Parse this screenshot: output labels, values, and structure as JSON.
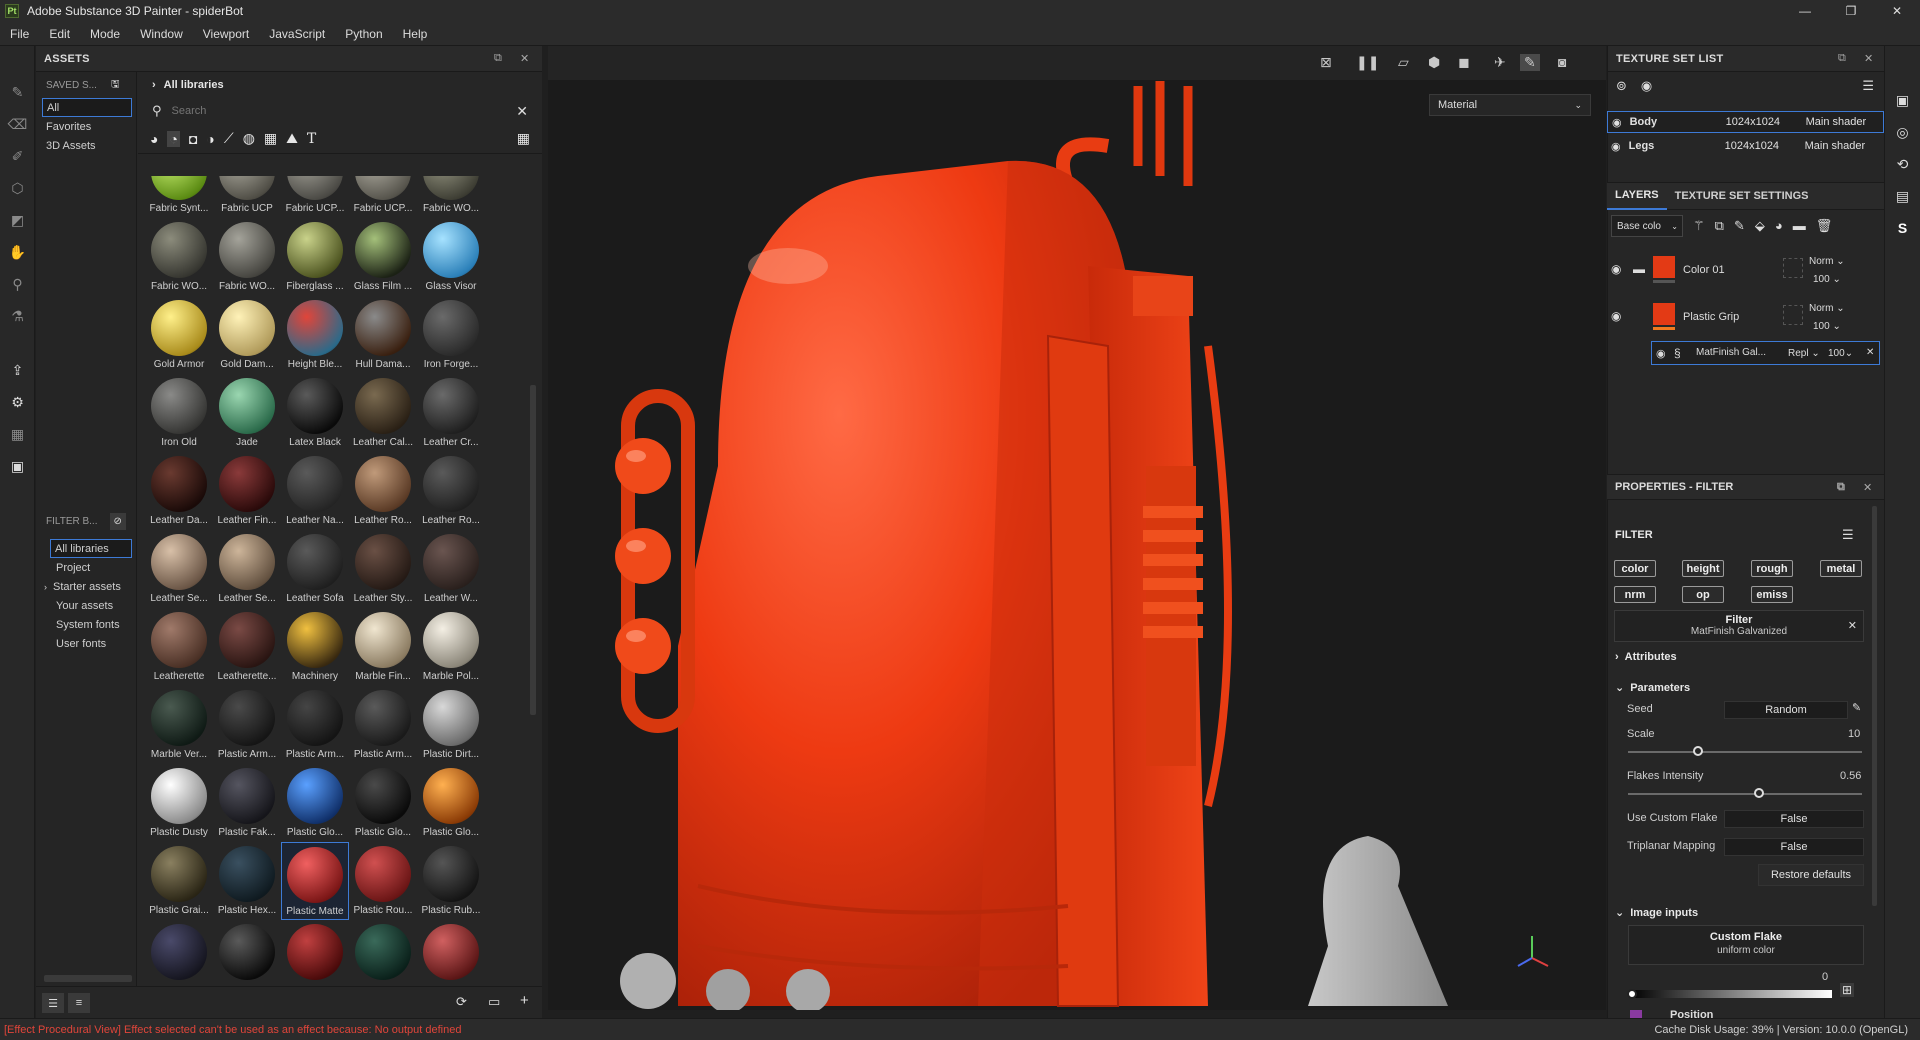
{
  "app": {
    "logo": "Pt",
    "title": "Adobe Substance 3D Painter - spiderBot",
    "window_controls": [
      "—",
      "❐",
      "✕"
    ]
  },
  "menu": [
    "File",
    "Edit",
    "Mode",
    "Window",
    "Viewport",
    "JavaScript",
    "Python",
    "Help"
  ],
  "left_tools": [
    "paint-brush-icon",
    "eraser-icon",
    "projection-icon",
    "geometry-fill-icon",
    "polygon-fill-icon",
    "smudge-icon",
    "clone-icon",
    "color-picker-icon",
    "export-icon",
    "bake-icon",
    "texture-icon",
    "screenshot-icon"
  ],
  "assets": {
    "title": "ASSETS",
    "saved_label": "SAVED S...",
    "side_items": [
      "All",
      "Favorites",
      "3D Assets"
    ],
    "filter_label": "FILTER B...",
    "libraries": [
      "All libraries",
      "Project",
      "Starter assets",
      "Your assets",
      "System fonts",
      "User fonts"
    ],
    "breadcrumb": "All libraries",
    "search_placeholder": "Search",
    "thumbs": [
      {
        "label": "Fabric Synt...",
        "c1": "#c8f070",
        "c2": "#5a8a12"
      },
      {
        "label": "Fabric UCP",
        "c1": "#b0aea2",
        "c2": "#4f4d45"
      },
      {
        "label": "Fabric UCP...",
        "c1": "#a8a69c",
        "c2": "#4a4944"
      },
      {
        "label": "Fabric UCP...",
        "c1": "#b5b2a6",
        "c2": "#55534b"
      },
      {
        "label": "Fabric WO...",
        "c1": "#9a9a86",
        "c2": "#3d3d33"
      },
      {
        "label": "Fabric WO...",
        "c1": "#8c8c7c",
        "c2": "#363630"
      },
      {
        "label": "Fabric WO...",
        "c1": "#a4a39a",
        "c2": "#45443f"
      },
      {
        "label": "Fiberglass ...",
        "c1": "#c9d28a",
        "c2": "#4d5420"
      },
      {
        "label": "Glass Film ...",
        "c1": "#a4c07a",
        "c2": "#1c2215"
      },
      {
        "label": "Glass Visor",
        "c1": "#a6e2ff",
        "c2": "#2a7fb8"
      },
      {
        "label": "Gold Armor",
        "c1": "#fff08a",
        "c2": "#a88a1a"
      },
      {
        "label": "Gold Dam...",
        "c1": "#fff2b8",
        "c2": "#b09a5a"
      },
      {
        "label": "Height Ble...",
        "c1": "#e0453a",
        "c2": "#2a6a8a"
      },
      {
        "label": "Hull Dama...",
        "c1": "#8a8a8a",
        "c2": "#3a2010"
      },
      {
        "label": "Iron Forge...",
        "c1": "#6a6a6a",
        "c2": "#2a2a2a"
      },
      {
        "label": "Iron Old",
        "c1": "#8a8a88",
        "c2": "#353533"
      },
      {
        "label": "Jade",
        "c1": "#9ad6b0",
        "c2": "#2a6a4a"
      },
      {
        "label": "Latex Black",
        "c1": "#5a5a5a",
        "c2": "#0a0a0a"
      },
      {
        "label": "Leather Cal...",
        "c1": "#7a6a50",
        "c2": "#2a2015"
      },
      {
        "label": "Leather Cr...",
        "c1": "#6a6a6a",
        "c2": "#1f1f1f"
      },
      {
        "label": "Leather Da...",
        "c1": "#6a3a30",
        "c2": "#1a0a08"
      },
      {
        "label": "Leather Fin...",
        "c1": "#8a3a3a",
        "c2": "#2a0a0a"
      },
      {
        "label": "Leather Na...",
        "c1": "#5a5a5a",
        "c2": "#252525"
      },
      {
        "label": "Leather Ro...",
        "c1": "#c09a7a",
        "c2": "#5a3a25"
      },
      {
        "label": "Leather Ro...",
        "c1": "#5a5a5a",
        "c2": "#202020"
      },
      {
        "label": "Leather Se...",
        "c1": "#d8c0a8",
        "c2": "#6a5545"
      },
      {
        "label": "Leather Se...",
        "c1": "#cdb59a",
        "c2": "#62503f"
      },
      {
        "label": "Leather Sofa",
        "c1": "#5a5a5a",
        "c2": "#1f1f1f"
      },
      {
        "label": "Leather Sty...",
        "c1": "#6a5045",
        "c2": "#251a15"
      },
      {
        "label": "Leather W...",
        "c1": "#6a5550",
        "c2": "#2a201d"
      },
      {
        "label": "Leatherette",
        "c1": "#a07a6a",
        "c2": "#4a3025"
      },
      {
        "label": "Leatherette...",
        "c1": "#7a4a45",
        "c2": "#2a1512"
      },
      {
        "label": "Machinery",
        "c1": "#f0c040",
        "c2": "#3a2a10"
      },
      {
        "label": "Marble Fin...",
        "c1": "#f0e6d0",
        "c2": "#8a7a60"
      },
      {
        "label": "Marble Pol...",
        "c1": "#f4efe4",
        "c2": "#8a8578"
      },
      {
        "label": "Marble Ver...",
        "c1": "#4a5a50",
        "c2": "#0f1a15"
      },
      {
        "label": "Plastic Arm...",
        "c1": "#4a4a4a",
        "c2": "#151515"
      },
      {
        "label": "Plastic Arm...",
        "c1": "#454545",
        "c2": "#141414"
      },
      {
        "label": "Plastic Arm...",
        "c1": "#5a5a5a",
        "c2": "#1a1a1a"
      },
      {
        "label": "Plastic Dirt...",
        "c1": "#d8d8d8",
        "c2": "#6a6a6a"
      },
      {
        "label": "Plastic Dusty",
        "c1": "#ffffff",
        "c2": "#8a8a8a"
      },
      {
        "label": "Plastic Fak...",
        "c1": "#555560",
        "c2": "#15151a"
      },
      {
        "label": "Plastic Glo...",
        "c1": "#5aa0ff",
        "c2": "#10306a"
      },
      {
        "label": "Plastic Glo...",
        "c1": "#4a4a4a",
        "c2": "#0a0a0a"
      },
      {
        "label": "Plastic Glo...",
        "c1": "#ffb050",
        "c2": "#8a3a05"
      },
      {
        "label": "Plastic Grai...",
        "c1": "#8a8060",
        "c2": "#2a2515"
      },
      {
        "label": "Plastic Hex...",
        "c1": "#3a5060",
        "c2": "#0f1a20"
      },
      {
        "label": "Plastic Matte",
        "c1": "#f06060",
        "c2": "#7a1515"
      },
      {
        "label": "Plastic Rou...",
        "c1": "#d05050",
        "c2": "#6a1515"
      },
      {
        "label": "Plastic Rub...",
        "c1": "#555555",
        "c2": "#141414"
      },
      {
        "label": "",
        "c1": "#4a4a6a",
        "c2": "#15151f"
      },
      {
        "label": "",
        "c1": "#5a5a5a",
        "c2": "#0a0a0a"
      },
      {
        "label": "",
        "c1": "#c04040",
        "c2": "#4a0a0a"
      },
      {
        "label": "",
        "c1": "#3a6a5a",
        "c2": "#0a201a"
      },
      {
        "label": "",
        "c1": "#d06060",
        "c2": "#5a1515"
      }
    ],
    "selected_index": 47
  },
  "viewport": {
    "channel_select": "Material"
  },
  "texture_set_list": {
    "title": "TEXTURE SET LIST",
    "rows": [
      {
        "name": "Body",
        "res": "1024x1024",
        "shader": "Main shader"
      },
      {
        "name": "Legs",
        "res": "1024x1024",
        "shader": "Main shader"
      }
    ]
  },
  "layers": {
    "tab_layers": "LAYERS",
    "tab_tss": "TEXTURE SET SETTINGS",
    "channel": "Base colo",
    "items": [
      {
        "name": "Color 01",
        "blend": "Norm",
        "opacity": "100"
      },
      {
        "name": "Plastic Grip",
        "blend": "Norm",
        "opacity": "100"
      }
    ],
    "effect": {
      "name": "MatFinish Gal...",
      "blend": "Repl",
      "opacity": "100"
    }
  },
  "properties": {
    "title": "PROPERTIES - FILTER",
    "filter_heading": "FILTER",
    "chips": [
      "color",
      "height",
      "rough",
      "metal",
      "nrm",
      "op",
      "emiss"
    ],
    "filter_box_title": "Filter",
    "filter_box_sub": "MatFinish Galvanized",
    "attributes": "Attributes",
    "parameters": "Parameters",
    "seed_label": "Seed",
    "seed_value": "Random",
    "scale_label": "Scale",
    "scale_value": "10",
    "scale_fraction": 0.3,
    "flakes_label": "Flakes Intensity",
    "flakes_value": "0.56",
    "flakes_fraction": 0.56,
    "custom_flake_label": "Use Custom Flake",
    "custom_flake_value": "False",
    "triplanar_label": "Triplanar Mapping",
    "triplanar_value": "False",
    "restore_btn": "Restore defaults",
    "image_inputs": "Image inputs",
    "custom_flake_box_title": "Custom Flake",
    "custom_flake_box_sub": "uniform color",
    "gradient_value": "0",
    "position_label": "Position"
  },
  "status": {
    "error": "[Effect Procedural View] Effect selected can't be used as an effect because: No output defined",
    "right": "Cache Disk Usage:   39% | Version: 10.0.0 (OpenGL)"
  }
}
